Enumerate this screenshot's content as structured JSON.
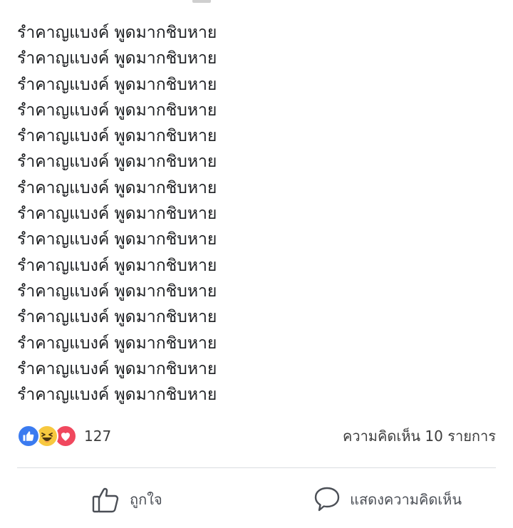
{
  "post": {
    "lines": [
      "รำคาญแบงค์ พูดมากชิบหาย",
      "รำคาญแบงค์ พูดมากชิบหาย",
      "รำคาญแบงค์ พูดมากชิบหาย",
      "รำคาญแบงค์ พูดมากชิบหาย",
      "รำคาญแบงค์ พูดมากชิบหาย",
      "รำคาญแบงค์ พูดมากชิบหาย",
      "รำคาญแบงค์ พูดมากชิบหาย",
      "รำคาญแบงค์ พูดมากชิบหาย",
      "รำคาญแบงค์ พูดมากชิบหาย",
      "รำคาญแบงค์ พูดมากชิบหาย",
      "รำคาญแบงค์ พูดมากชิบหาย",
      "รำคาญแบงค์ พูดมากชิบหาย",
      "รำคาญแบงค์ พูดมากชิบหาย",
      "รำคาญแบงค์ พูดมากชิบหาย",
      "รำคาญแบงค์ พูดมากชิบหาย"
    ]
  },
  "reactions": {
    "icons": [
      "like-icon",
      "haha-icon",
      "love-icon"
    ],
    "colors": {
      "like": "#3b7bf0",
      "haha": "#f7c83f",
      "love": "#f0485e"
    },
    "count": "127"
  },
  "comments": {
    "summary": "ความคิดเห็น 10 รายการ"
  },
  "actions": {
    "like_label": "ถูกใจ",
    "comment_label": "แสดงความคิดเห็น"
  }
}
